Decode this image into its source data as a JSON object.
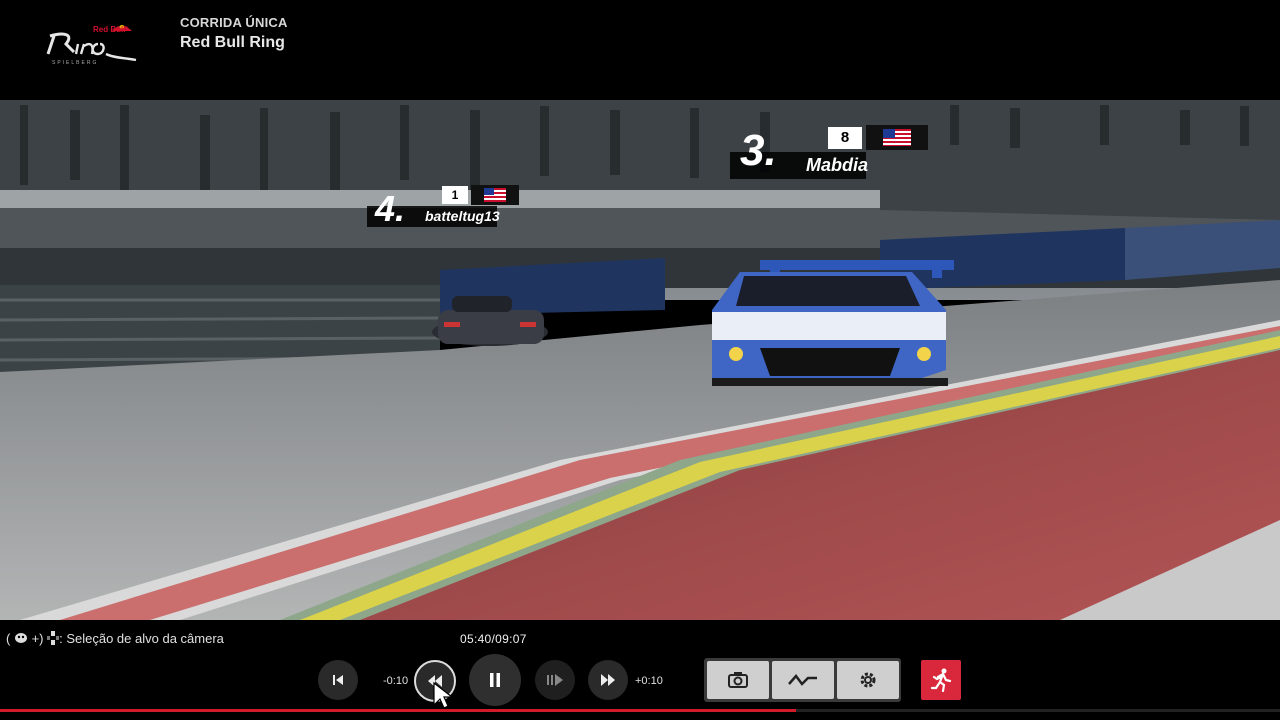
{
  "header": {
    "event_type": "CORRIDA ÚNICA",
    "track_name": "Red Bull Ring",
    "logo": {
      "brand": "Red Bull",
      "word": "Ring",
      "sub": "SPIELBERG"
    }
  },
  "drivers": [
    {
      "position": "3.",
      "number": "8",
      "name": "Mabdia",
      "flag": "us-flag-icon"
    },
    {
      "position": "4.",
      "number": "1",
      "name": "batteltug13",
      "flag": "us-flag-icon"
    }
  ],
  "controls": {
    "hint_text": "Seleção de alvo da câmera",
    "timestamp": "05:40/09:07",
    "back_label": "-0:10",
    "forward_label": "+0:10",
    "progress": 0.622,
    "buttons": [
      "skip-to-start-icon",
      "rewind-icon",
      "pause-icon",
      "frame-step-icon",
      "fast-forward-icon"
    ],
    "tools": [
      "camera-icon",
      "telemetry-icon",
      "gear-icon"
    ],
    "exit_icon": "exit-runner-icon"
  },
  "colors": {
    "accent_red": "#d9283c",
    "car_blue": "#2d57b8"
  }
}
